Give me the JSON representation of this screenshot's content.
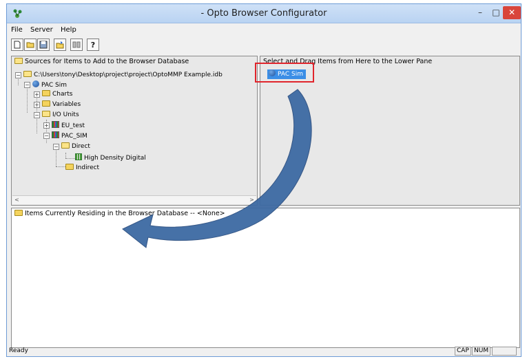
{
  "window": {
    "title": "- Opto Browser Configurator",
    "minimize_glyph": "–",
    "maximize_glyph": "□",
    "close_glyph": "✕"
  },
  "menu": {
    "items": [
      "File",
      "Server",
      "Help"
    ]
  },
  "toolbar": {
    "icons": [
      "new-icon",
      "open-icon",
      "save-icon",
      "import-icon",
      "refresh-icon",
      "help-icon"
    ],
    "help_glyph": "?"
  },
  "left_pane": {
    "header": "Sources for Items to Add to the Browser Database",
    "tree": {
      "root": "C:\\Users\\tony\\Desktop\\project\\project\\OptoMMP Example.idb",
      "strategy": "PAC Sim",
      "charts": "Charts",
      "variables": "Variables",
      "io_units": "I/O Units",
      "eu_test": "EU_test",
      "pac_sim_unit": "PAC_SIM",
      "direct": "Direct",
      "high_density": "High Density Digital",
      "indirect": "Indirect"
    },
    "scroll_left": "<",
    "scroll_right": ">"
  },
  "right_pane": {
    "header": "Select and Drag Items from Here to the Lower Pane",
    "selected_item": "PAC Sim"
  },
  "bottom_pane": {
    "header": "Items Currently Residing in the Browser Database -- <None>"
  },
  "status": {
    "text": "Ready",
    "cap": "CAP",
    "num": "NUM"
  },
  "colors": {
    "arrow": "#3d6aa3",
    "highlight": "#e0242b",
    "selection": "#3b8ee6",
    "close_button": "#d9453b"
  }
}
